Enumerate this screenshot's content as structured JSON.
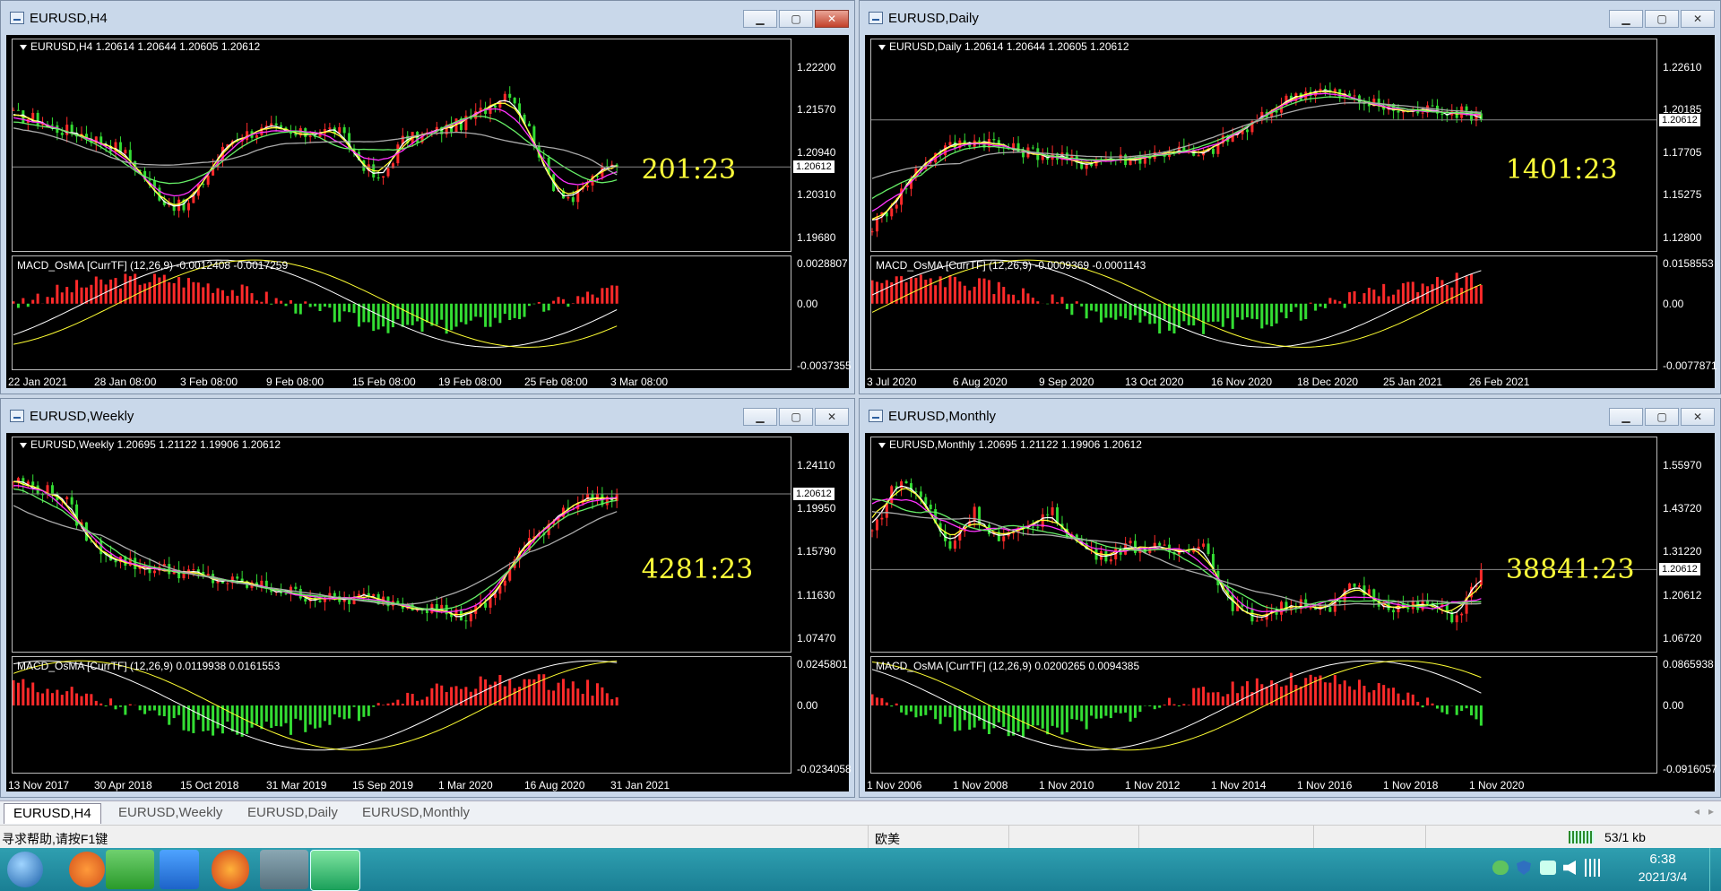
{
  "windows": [
    {
      "id": "h4",
      "title": "EURUSD,H4",
      "header": "EURUSD,H4  1.20614 1.20644 1.20605 1.20612",
      "macd_header": "MACD_OsMA [CurrTF] (12,26,9) -0.0012408 -0.0017259",
      "price_labels": [
        "1.22200",
        "1.21570",
        "1.20940",
        "1.20310",
        "1.19680"
      ],
      "price_box": "1.20612",
      "macd_labels": [
        "0.0028807",
        "0.00",
        "-0.0037355"
      ],
      "time_labels": [
        "22 Jan 2021",
        "28 Jan 08:00",
        "3 Feb 08:00",
        "9 Feb 08:00",
        "15 Feb 08:00",
        "19 Feb 08:00",
        "25 Feb 08:00",
        "3 Mar 08:00"
      ],
      "counter": "201:23"
    },
    {
      "id": "daily",
      "title": "EURUSD,Daily",
      "header": "EURUSD,Daily  1.20614 1.20644 1.20605 1.20612",
      "macd_header": "MACD_OsMA [CurrTF] (12,26,9) -0.0009369 -0.0001143",
      "price_labels": [
        "1.22610",
        "1.20185",
        "1.17705",
        "1.15275",
        "1.12800"
      ],
      "price_box": "1.20612",
      "macd_labels": [
        "0.0158553",
        "0.00",
        "-0.0077871"
      ],
      "time_labels": [
        "3 Jul 2020",
        "6 Aug 2020",
        "9 Sep 2020",
        "13 Oct 2020",
        "16 Nov 2020",
        "18 Dec 2020",
        "25 Jan 2021",
        "26 Feb 2021"
      ],
      "counter": "1401:23"
    },
    {
      "id": "weekly",
      "title": "EURUSD,Weekly",
      "header": "EURUSD,Weekly  1.20695 1.21122 1.19906 1.20612",
      "macd_header": "MACD_OsMA [CurrTF] (12,26,9) 0.0119938 0.0161553",
      "price_labels": [
        "1.24110",
        "1.19950",
        "1.15790",
        "1.11630",
        "1.07470"
      ],
      "price_box": "1.20612",
      "macd_labels": [
        "0.0245801",
        "0.00",
        "-0.0234058"
      ],
      "time_labels": [
        "13 Nov 2017",
        "30 Apr 2018",
        "15 Oct 2018",
        "31 Mar 2019",
        "15 Sep 2019",
        "1 Mar 2020",
        "16 Aug 2020",
        "31 Jan 2021"
      ],
      "counter": "4281:23"
    },
    {
      "id": "monthly",
      "title": "EURUSD,Monthly",
      "header": "EURUSD,Monthly  1.20695 1.21122 1.19906 1.20612",
      "macd_header": "MACD_OsMA [CurrTF] (12,26,9) 0.0200265 0.0094385",
      "price_labels": [
        "1.55970",
        "1.43720",
        "1.31220",
        "1.20612",
        "1.06720"
      ],
      "price_box": "1.20612",
      "macd_labels": [
        "0.0865938",
        "0.00",
        "-0.0916057"
      ],
      "time_labels": [
        "1 Nov 2006",
        "1 Nov 2008",
        "1 Nov 2010",
        "1 Nov 2012",
        "1 Nov 2014",
        "1 Nov 2016",
        "1 Nov 2018",
        "1 Nov 2020"
      ],
      "counter": "38841:23"
    }
  ],
  "tabs": [
    "EURUSD,H4",
    "EURUSD,Weekly",
    "EURUSD,Daily",
    "EURUSD,Monthly"
  ],
  "status": {
    "help": "寻求帮助,请按F1键",
    "profile": "欧美",
    "traffic": "53/1 kb"
  },
  "clock": {
    "time": "6:38",
    "date": "2021/3/4"
  },
  "colors": {
    "bull": "#ff2a2a",
    "bear": "#33dd33",
    "ma_white": "#ffffff",
    "ma_yellow": "#ffff33",
    "ma_magenta": "#ff33ff",
    "ma_green": "#66ee66",
    "ma_gray": "#aaaaaa",
    "counter": "#ffff3a"
  }
}
